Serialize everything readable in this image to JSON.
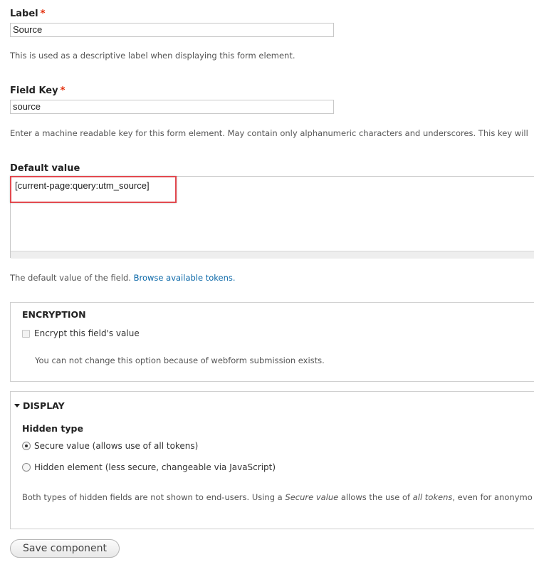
{
  "label_field": {
    "label": "Label",
    "required_marker": "*",
    "value": "Source",
    "description": "This is used as a descriptive label when displaying this form element."
  },
  "key_field": {
    "label": "Field Key",
    "required_marker": "*",
    "value": "source",
    "description": "Enter a machine readable key for this form element. May contain only alphanumeric characters and underscores. This key will"
  },
  "default_value": {
    "label": "Default value",
    "value": "[current-page:query:utm_source]",
    "description": "The default value of the field.",
    "link_text": "Browse available tokens."
  },
  "encryption": {
    "legend": "ENCRYPTION",
    "checkbox_label": "Encrypt this field's value",
    "note": "You can not change this option because of webform submission exists."
  },
  "display": {
    "legend": "DISPLAY",
    "hidden_type_label": "Hidden type",
    "options": [
      {
        "label": "Secure value (allows use of all tokens)",
        "selected": true
      },
      {
        "label": "Hidden element (less secure, changeable via JavaScript)",
        "selected": false
      }
    ],
    "note_pre": "Both types of hidden fields are not shown to end-users. Using a ",
    "note_em1": "Secure value",
    "note_mid": " allows the use of ",
    "note_em2": "all tokens",
    "note_post": ", even for anonymo"
  },
  "actions": {
    "save_label": "Save component"
  },
  "colors": {
    "required": "#e32700",
    "link": "#0b68a8",
    "highlight_box": "#e2494f"
  },
  "icons": {
    "collapse_toggle": "triangle-down-icon"
  }
}
